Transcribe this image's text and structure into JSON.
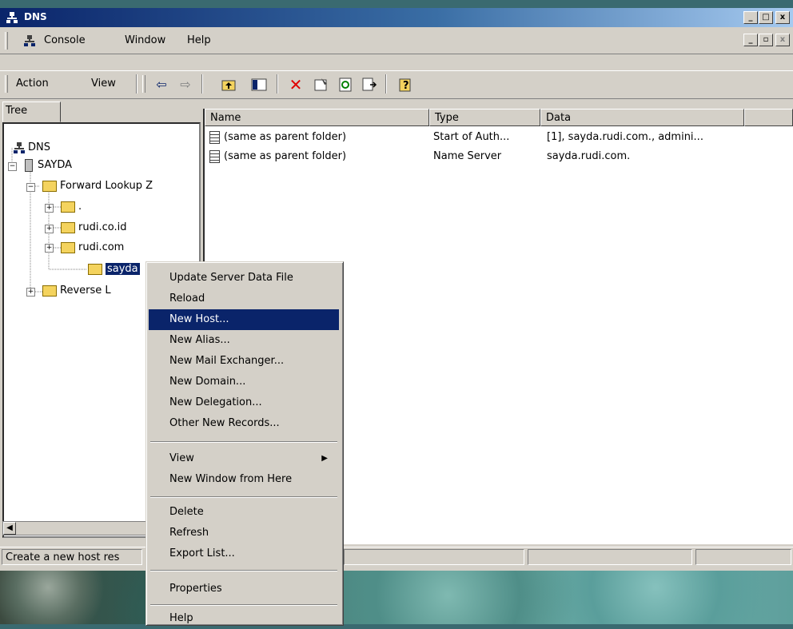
{
  "window": {
    "title": "DNS",
    "controls": [
      "_",
      "□",
      "x"
    ]
  },
  "menubar": {
    "items": [
      "Console",
      "Window",
      "Help"
    ],
    "mdi_controls": [
      "_",
      "▫",
      "x"
    ]
  },
  "toolbar": {
    "action_label": "Action",
    "view_label": "View",
    "icons": [
      "back-arrow",
      "forward-arrow",
      "up-folder",
      "show-hide-tree",
      "delete",
      "properties",
      "refresh",
      "export-list",
      "help"
    ]
  },
  "tree": {
    "tab_label": "Tree",
    "items": [
      {
        "label": "DNS",
        "level": 0
      },
      {
        "label": "SAYDA",
        "level": 1
      },
      {
        "label": "Forward Lookup Z",
        "level": 2
      },
      {
        "label": ".",
        "level": 3
      },
      {
        "label": "rudi.co.id",
        "level": 3
      },
      {
        "label": "rudi.com",
        "level": 3
      },
      {
        "label": "sayda",
        "level": 3
      },
      {
        "label": "Reverse L",
        "level": 2
      }
    ]
  },
  "list": {
    "columns": [
      "Name",
      "Type",
      "Data"
    ],
    "rows": [
      {
        "name": "(same as parent folder)",
        "type": "Start of Auth...",
        "data": "[1], sayda.rudi.com., admini..."
      },
      {
        "name": "(same as parent folder)",
        "type": "Name Server",
        "data": "sayda.rudi.com."
      }
    ]
  },
  "status": {
    "text": "Create a new host res"
  },
  "context_menu": {
    "items": [
      {
        "label": "Update Server Data File"
      },
      {
        "label": "Reload"
      },
      {
        "label": "New Host...",
        "selected": true
      },
      {
        "label": "New Alias..."
      },
      {
        "label": "New Mail Exchanger..."
      },
      {
        "label": "New Domain..."
      },
      {
        "label": "New Delegation..."
      },
      {
        "label": "Other New Records..."
      },
      {
        "label": "View",
        "submenu": true
      },
      {
        "label": "New Window from Here"
      },
      {
        "label": "Delete"
      },
      {
        "label": "Refresh"
      },
      {
        "label": "Export List..."
      },
      {
        "label": "Properties"
      },
      {
        "label": "Help"
      }
    ]
  },
  "colors": {
    "titlebar_start": "#0a246a",
    "titlebar_end": "#a6caf0",
    "selection": "#0a246a",
    "face": "#d4d0c8"
  }
}
